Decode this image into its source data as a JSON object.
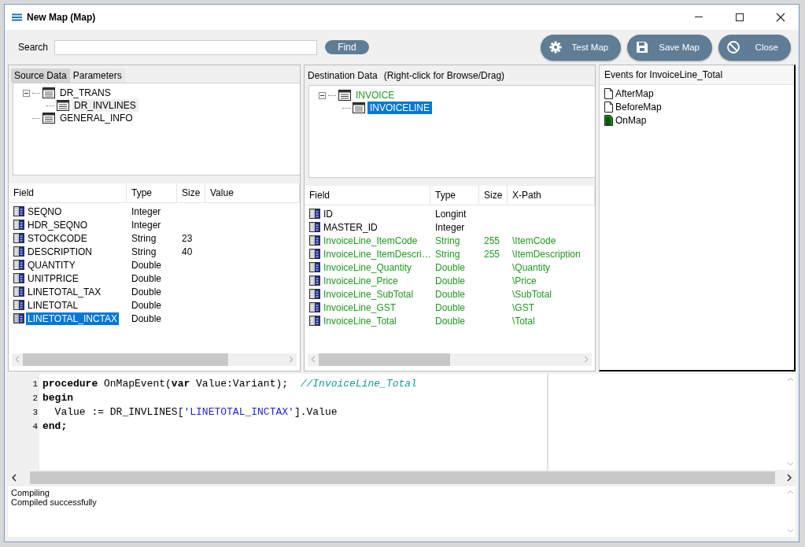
{
  "window": {
    "title": "New Map (Map)"
  },
  "search": {
    "label": "Search",
    "button": "Find"
  },
  "actions": [
    {
      "label": "Test Map",
      "kind": "test"
    },
    {
      "label": "Save Map",
      "kind": "save"
    },
    {
      "label": "Close",
      "kind": "close"
    }
  ],
  "source": {
    "tabs": [
      {
        "label": "Source Data",
        "selected": true
      },
      {
        "label": "Parameters",
        "selected": false
      }
    ],
    "tree": [
      {
        "label": "DR_TRANS",
        "selected": false,
        "expanded": true,
        "children": [
          {
            "label": "DR_INVLINES",
            "selected": true,
            "expanded": false
          }
        ]
      },
      {
        "label": "GENERAL_INFO",
        "selected": false,
        "expanded": false
      }
    ],
    "columns": [
      "Field",
      "Type",
      "Size",
      "Value"
    ],
    "rows": [
      {
        "cells": [
          "SEQNO",
          "Integer",
          "",
          ""
        ],
        "selected": false
      },
      {
        "cells": [
          "HDR_SEQNO",
          "Integer",
          "",
          ""
        ],
        "selected": false
      },
      {
        "cells": [
          "STOCKCODE",
          "String",
          "23",
          ""
        ],
        "selected": false
      },
      {
        "cells": [
          "DESCRIPTION",
          "String",
          "40",
          ""
        ],
        "selected": false
      },
      {
        "cells": [
          "QUANTITY",
          "Double",
          "",
          ""
        ],
        "selected": false
      },
      {
        "cells": [
          "UNITPRICE",
          "Double",
          "",
          ""
        ],
        "selected": false
      },
      {
        "cells": [
          "LINETOTAL_TAX",
          "Double",
          "",
          ""
        ],
        "selected": false
      },
      {
        "cells": [
          "LINETOTAL",
          "Double",
          "",
          ""
        ],
        "selected": false
      },
      {
        "cells": [
          "LINETOTAL_INCTAX",
          "Double",
          "",
          ""
        ],
        "selected": true
      }
    ]
  },
  "destination": {
    "title": "Destination Data",
    "hint": "(Right-click for Browse/Drag)",
    "tree": [
      {
        "label": "INVOICE",
        "mapped": true,
        "selected": false,
        "expanded": true,
        "children": [
          {
            "label": "INVOICELINE",
            "mapped": false,
            "selected": true,
            "expanded": false
          }
        ]
      }
    ],
    "columns": [
      "Field",
      "Type",
      "Size",
      "X-Path"
    ],
    "rows": [
      {
        "cells": [
          "ID",
          "Longint",
          "",
          ""
        ],
        "mapped": false
      },
      {
        "cells": [
          "MASTER_ID",
          "Integer",
          "",
          ""
        ],
        "mapped": false
      },
      {
        "cells": [
          "InvoiceLine_ItemCode",
          "String",
          "255",
          "\\ItemCode"
        ],
        "mapped": true
      },
      {
        "cells": [
          "InvoiceLine_ItemDescri…",
          "String",
          "255",
          "\\ItemDescription"
        ],
        "mapped": true
      },
      {
        "cells": [
          "InvoiceLine_Quantity",
          "Double",
          "",
          "\\Quantity"
        ],
        "mapped": true
      },
      {
        "cells": [
          "InvoiceLine_Price",
          "Double",
          "",
          "\\Price"
        ],
        "mapped": true
      },
      {
        "cells": [
          "InvoiceLine_SubTotal",
          "Double",
          "",
          "\\SubTotal"
        ],
        "mapped": true
      },
      {
        "cells": [
          "InvoiceLine_GST",
          "Double",
          "",
          "\\GST"
        ],
        "mapped": true
      },
      {
        "cells": [
          "InvoiceLine_Total",
          "Double",
          "",
          "\\Total"
        ],
        "mapped": true
      }
    ]
  },
  "events": {
    "title": "Events for InvoiceLine_Total",
    "items": [
      {
        "label": "AfterMap",
        "has_code": false
      },
      {
        "label": "BeforeMap",
        "has_code": false
      },
      {
        "label": "OnMap",
        "has_code": true
      }
    ]
  },
  "code": [
    {
      "number": "1",
      "tokens": [
        {
          "kind": "keyword",
          "text": "procedure"
        },
        {
          "kind": "plain",
          "text": " OnMapEvent("
        },
        {
          "kind": "keyword",
          "text": "var"
        },
        {
          "kind": "plain",
          "text": " Value:Variant);  "
        },
        {
          "kind": "comment",
          "text": "//InvoiceLine_Total"
        }
      ]
    },
    {
      "number": "2",
      "tokens": [
        {
          "kind": "keyword",
          "text": "begin"
        }
      ]
    },
    {
      "number": "3",
      "tokens": [
        {
          "kind": "plain",
          "text": "  Value := DR_INVLINES["
        },
        {
          "kind": "string",
          "text": "'LINETOTAL_INCTAX'"
        },
        {
          "kind": "plain",
          "text": "].Value"
        }
      ]
    },
    {
      "number": "4",
      "tokens": [
        {
          "kind": "keyword",
          "text": "end;"
        }
      ]
    }
  ],
  "output": [
    "Compiling",
    "Compiled successfully"
  ]
}
